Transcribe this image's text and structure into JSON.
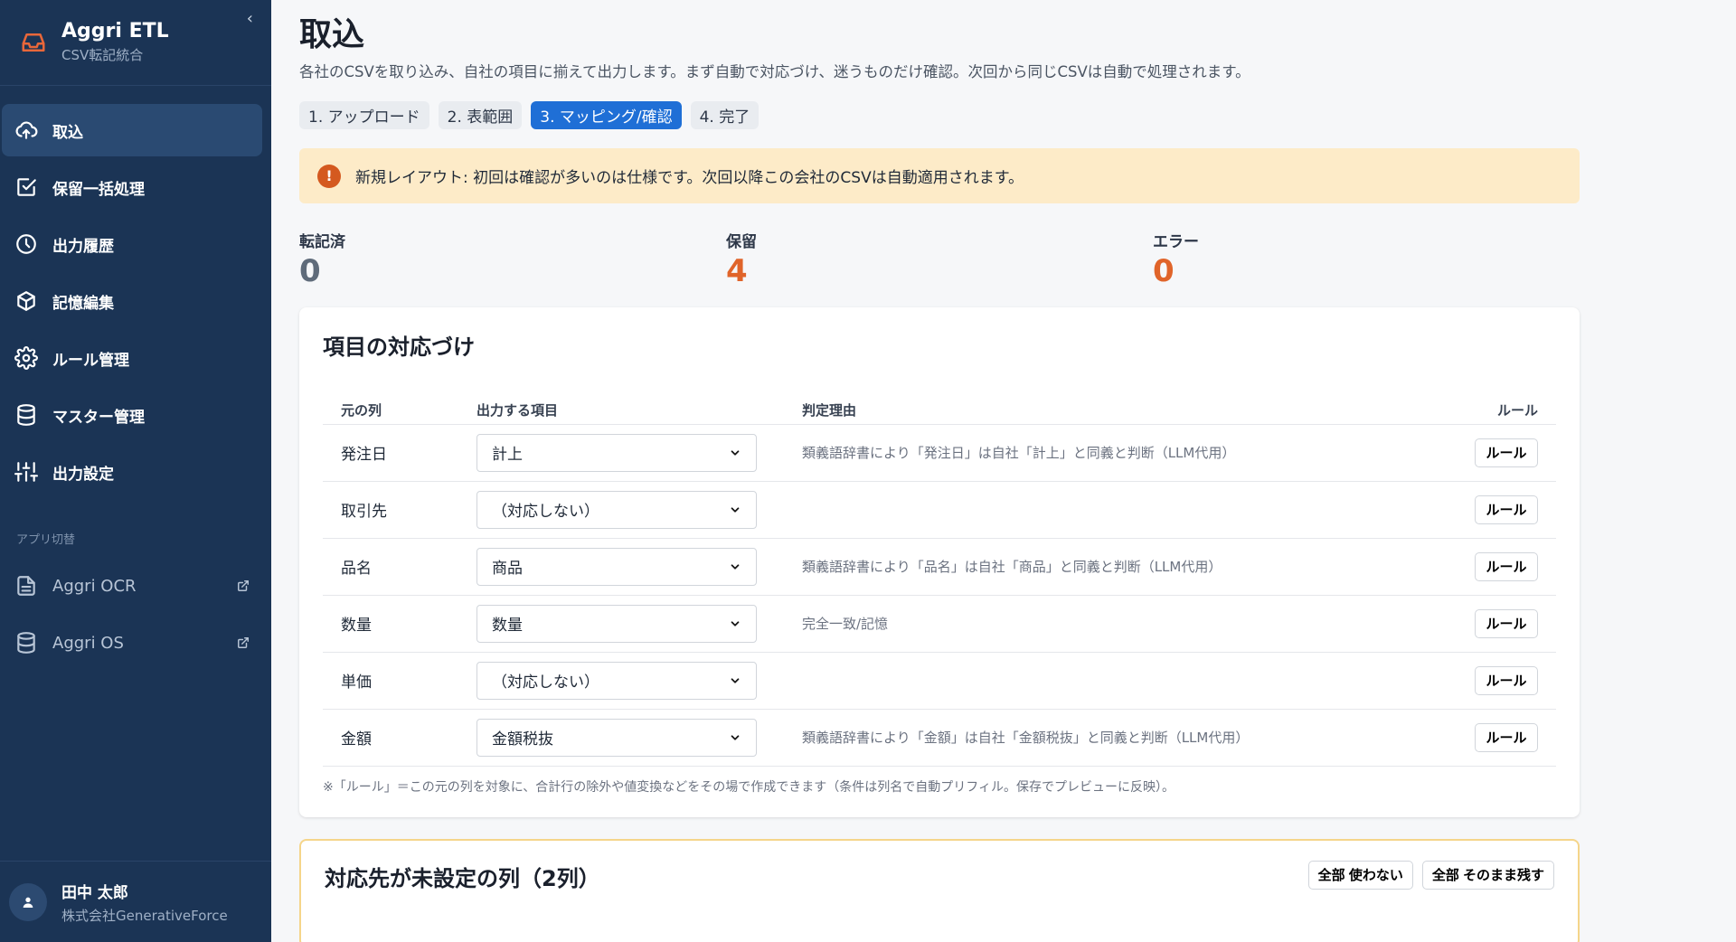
{
  "app": {
    "name": "Aggri ETL",
    "subtitle": "CSV転記統合",
    "collapse": "‹"
  },
  "sidebar": {
    "items": [
      {
        "label": "取込",
        "icon": "upload-cloud-icon",
        "active": true
      },
      {
        "label": "保留一括処理",
        "icon": "checkbox-edit-icon"
      },
      {
        "label": "出力履歴",
        "icon": "clock-icon"
      },
      {
        "label": "記憶編集",
        "icon": "cube-icon"
      },
      {
        "label": "ルール管理",
        "icon": "gear-icon"
      },
      {
        "label": "マスター管理",
        "icon": "database-icon"
      },
      {
        "label": "出力設定",
        "icon": "sliders-icon"
      }
    ],
    "section_label": "アプリ切替",
    "apps": [
      {
        "label": "Aggri OCR",
        "icon": "document-icon"
      },
      {
        "label": "Aggri OS",
        "icon": "database-icon"
      }
    ],
    "user": {
      "name": "田中 太郎",
      "org": "株式会社GenerativeForce"
    }
  },
  "page": {
    "title": "取込",
    "description": "各社のCSVを取り込み、自社の項目に揃えて出力します。まず自動で対応づけ、迷うものだけ確認。次回から同じCSVは自動で処理されます。",
    "steps": [
      "1. アップロード",
      "2. 表範囲",
      "3. マッピング/確認",
      "4. 完了"
    ],
    "active_step": 2,
    "alert": "新規レイアウト: 初回は確認が多いのは仕様です。次回以降この会社のCSVは自動適用されます。",
    "stats": [
      {
        "label": "転記済",
        "value": "0",
        "color": "#5f6b7a"
      },
      {
        "label": "保留",
        "value": "4",
        "color": "#e0642a"
      },
      {
        "label": "エラー",
        "value": "0",
        "color": "#e0642a"
      }
    ]
  },
  "mapping": {
    "title": "項目の対応づけ",
    "headers": {
      "source": "元の列",
      "target": "出力する項目",
      "reason": "判定理由",
      "rule": "ルール"
    },
    "rows": [
      {
        "source": "発注日",
        "target": "計上",
        "reason": "類義語辞書により「発注日」は自社「計上」と同義と判断（LLM代用）",
        "rule": "ルール"
      },
      {
        "source": "取引先",
        "target": "（対応しない）",
        "reason": "",
        "rule": "ルール"
      },
      {
        "source": "品名",
        "target": "商品",
        "reason": "類義語辞書により「品名」は自社「商品」と同義と判断（LLM代用）",
        "rule": "ルール"
      },
      {
        "source": "数量",
        "target": "数量",
        "reason": "完全一致/記憶",
        "rule": "ルール"
      },
      {
        "source": "単価",
        "target": "（対応しない）",
        "reason": "",
        "rule": "ルール"
      },
      {
        "source": "金額",
        "target": "金額税抜",
        "reason": "類義語辞書により「金額」は自社「金額税抜」と同義と判断（LLM代用）",
        "rule": "ルール"
      }
    ],
    "note": "※「ルール」＝この元の列を対象に、合計行の除外や値変換などをその場で作成できます（条件は列名で自動プリフィル。保存でプレビューに反映）。"
  },
  "unmapped": {
    "title": "対応先が未設定の列（2列）",
    "btn_unuse": "全部 使わない",
    "btn_keep": "全部 そのまま残す"
  }
}
